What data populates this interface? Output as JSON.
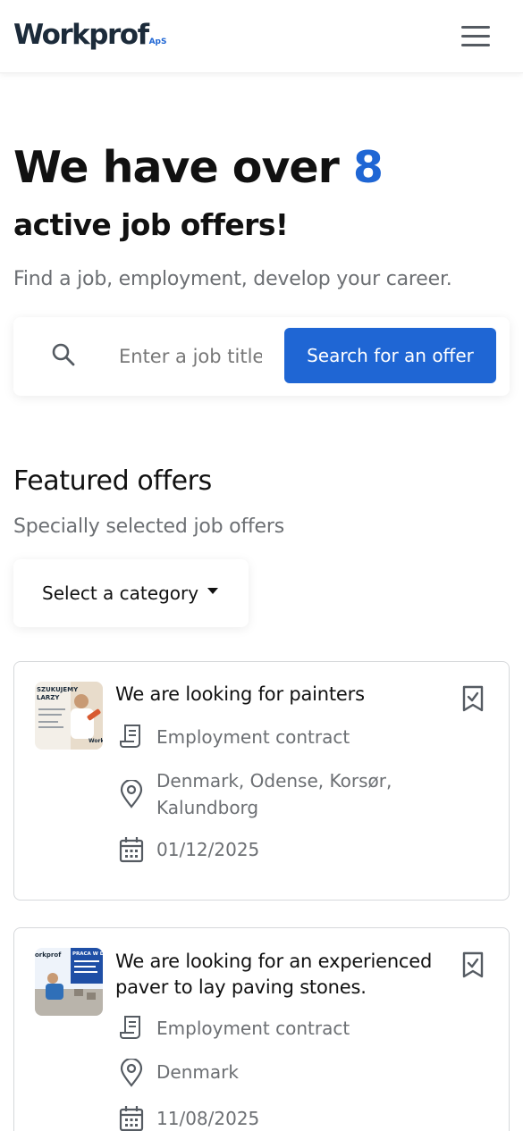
{
  "header": {
    "logo_text": "Workprof",
    "logo_suffix": "ApS",
    "menu_icon": "hamburger-menu-icon"
  },
  "hero": {
    "title_prefix": "We have over ",
    "count": "8",
    "subtitle": "active job offers!",
    "description": "Find a job, employment, develop your career."
  },
  "search": {
    "icon": "search-icon",
    "placeholder": "Enter a job title",
    "button_label": "Search for an offer"
  },
  "featured": {
    "title": "Featured offers",
    "subtitle": "Specially selected job offers",
    "category_label": "Select a category"
  },
  "offers": [
    {
      "title": "We are looking for painters",
      "thumbnail_text": "SZUKUJEMY\nLARZY",
      "thumbnail_brand": "Work",
      "contract": "Employment contract",
      "location": "Denmark, Odense, Korsør, Kalundborg",
      "date": "01/12/2025"
    },
    {
      "title": "We are looking for an experienced paver to lay paving stones.",
      "thumbnail_text": "PRACA W DA",
      "thumbnail_brand": "orkprof",
      "contract": "Employment contract",
      "location": "Denmark",
      "date": "11/08/2025"
    }
  ],
  "colors": {
    "accent": "#1f66d4",
    "text": "#111111",
    "muted": "#6c6f73",
    "border": "#d6d8db"
  }
}
